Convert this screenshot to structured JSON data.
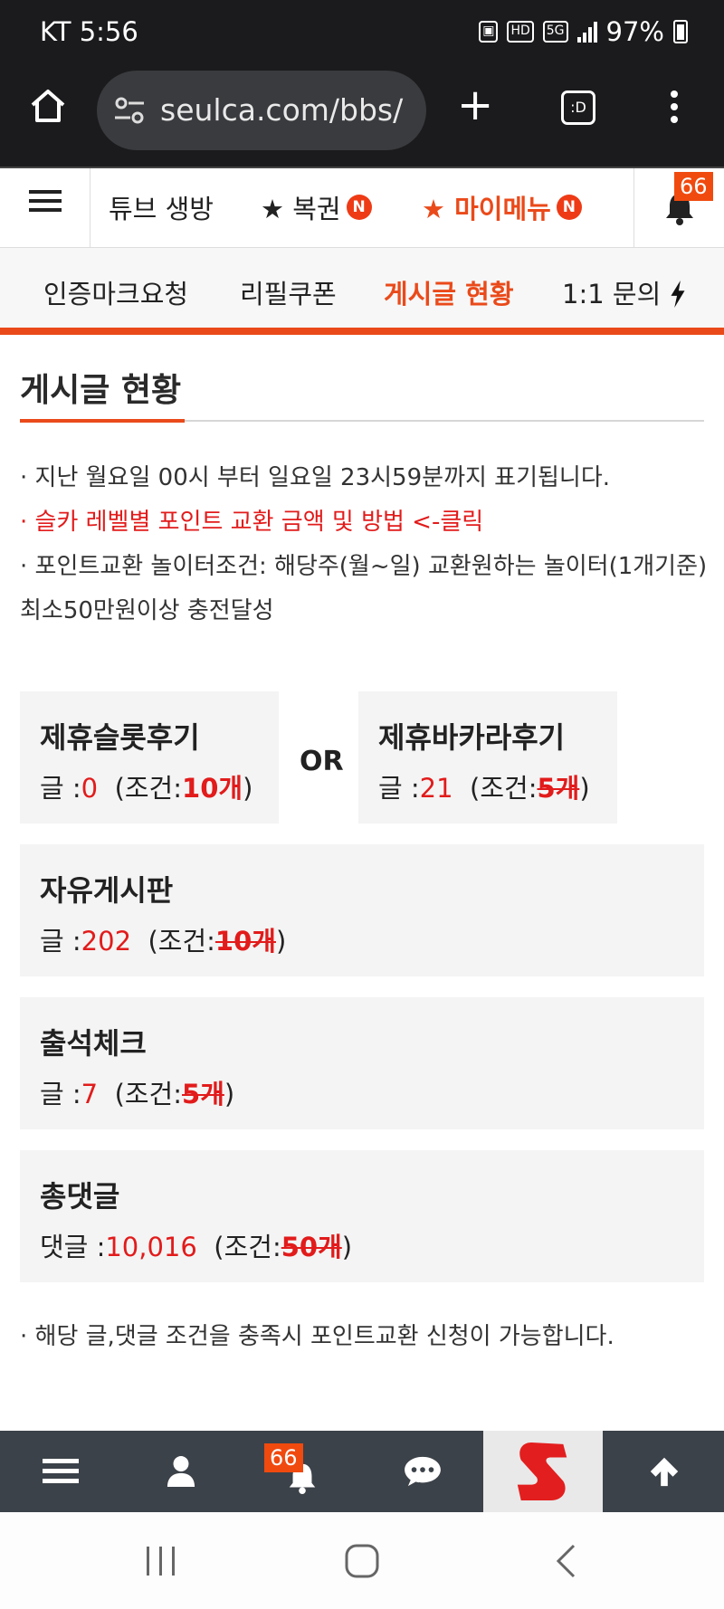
{
  "status_bar": {
    "carrier_time": "KT 5:56",
    "hd_label": "HD",
    "fiveg_label": "5G",
    "battery": "97%"
  },
  "browser": {
    "url": "seulca.com/bbs/",
    "tabs_label": ":D"
  },
  "site_menu": {
    "items": [
      {
        "label": "튜브 생방"
      },
      {
        "label": "★ 복권",
        "badge": "N"
      },
      {
        "label": "★ 마이메뉴",
        "badge": "N"
      }
    ],
    "notification_count": "66"
  },
  "sub_nav": {
    "items": [
      {
        "label": "인증마크요청"
      },
      {
        "label": "리필쿠폰"
      },
      {
        "label": "게시글 현황"
      },
      {
        "label": "1:1 문의"
      }
    ]
  },
  "page": {
    "title": "게시글 현황",
    "notices": [
      "· 지난 월요일 00시 부터 일요일 23시59분까지 표기됩니다.",
      "· 슬카 레벨별 포인트 교환 금액 및 방법 <-클릭",
      "· 포인트교환 놀이터조건: 해당주(월~일) 교환원하는 놀이터(1개기준) 최소50만원이상 충전달성"
    ],
    "or_label": "OR",
    "cards": [
      {
        "title": "제휴슬롯후기",
        "prefix": "글 :",
        "value": "0",
        "cond_open": "(조건:",
        "cond_value": "10개",
        "cond_close": ")"
      },
      {
        "title": "제휴바카라후기",
        "prefix": "글 :",
        "value": "21",
        "cond_open": "(조건:",
        "cond_value": "5개",
        "cond_close": ")"
      },
      {
        "title": "자유게시판",
        "prefix": "글 :",
        "value": "202",
        "cond_open": "(조건:",
        "cond_value": "10개",
        "cond_close": ")"
      },
      {
        "title": "출석체크",
        "prefix": "글 :",
        "value": "7",
        "cond_open": "(조건:",
        "cond_value": "5개",
        "cond_close": ")"
      },
      {
        "title": "총댓글",
        "prefix": "댓글 :",
        "value": "10,016",
        "cond_open": "(조건:",
        "cond_value": "50개",
        "cond_close": ")"
      }
    ],
    "footer_notice": "· 해당 글,댓글 조건을 충족시 포인트교환 신청이 가능합니다."
  },
  "bottom_nav": {
    "notification_count": "66"
  },
  "colors": {
    "accent": "#ea4a1a",
    "red": "#e21b1b",
    "dark_bar": "#1b1b1d",
    "bottom_nav": "#3c4249"
  }
}
